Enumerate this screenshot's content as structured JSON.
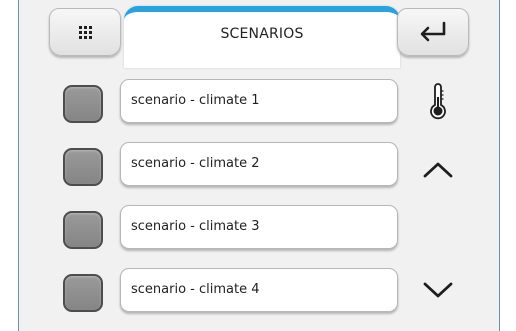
{
  "header": {
    "title": "SCENARIOS",
    "menu_icon": "grid-menu-icon",
    "back_icon": "return-arrow-icon",
    "accent_color": "#27a3e0"
  },
  "scenarios": [
    {
      "label": "scenario - climate 1",
      "checked": false
    },
    {
      "label": "scenario - climate 2",
      "checked": false
    },
    {
      "label": "scenario - climate 3",
      "checked": false
    },
    {
      "label": "scenario - climate 4",
      "checked": false
    }
  ],
  "side_icons": {
    "category": "thermometer-icon",
    "up": "chevron-up-icon",
    "down": "chevron-down-icon"
  }
}
